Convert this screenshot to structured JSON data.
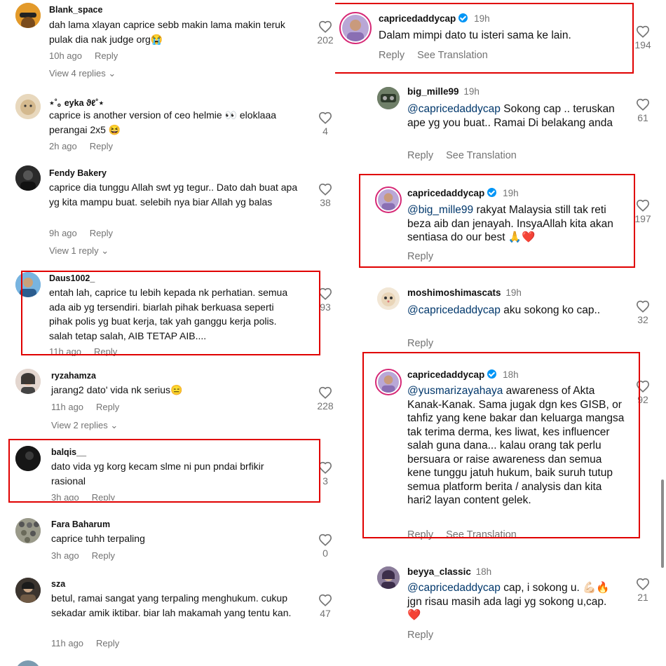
{
  "left_comments": [
    {
      "user": "Blank_space",
      "text": "dah lama xlayan caprice sebb makin lama makin teruk pulak dia nak judge org😭",
      "time": "10h ago",
      "reply": "Reply",
      "likes": "202",
      "view_replies": "View 4 replies"
    },
    {
      "user": "⋆˚｡ eyka ϑℓ˚⋆",
      "text": "caprice is another version of ceo helmie 👀 eloklaaa perangai 2x5 😆",
      "time": "2h ago",
      "reply": "Reply",
      "likes": "4"
    },
    {
      "user": "Fendy Bakery",
      "text": "caprice dia tunggu Allah swt yg tegur.. Dato dah buat apa yg kita mampu buat. selebih nya biar Allah yg balas",
      "time": "9h ago",
      "reply": "Reply",
      "likes": "38",
      "view_replies": "View 1 reply"
    },
    {
      "user": "Daus1002_",
      "text": "entah lah, caprice tu lebih kepada nk perhatian. semua ada aib yg tersendiri. biarlah pihak berkuasa seperti pihak polis yg buat kerja, tak yah ganggu kerja polis. salah tetap salah, AIB TETAP AIB....",
      "time": "11h ago",
      "reply": "Reply",
      "likes": "93"
    },
    {
      "user": "ryzahamza",
      "text": "jarang2 dato' vida nk serius😑",
      "time": "11h ago",
      "reply": "Reply",
      "likes": "228",
      "view_replies": "View 2 replies"
    },
    {
      "user": "balqis__",
      "text": "dato vida yg korg kecam slme ni pun pndai brfikir rasional",
      "time": "3h ago",
      "reply": "Reply",
      "likes": "3"
    },
    {
      "user": "Fara Baharum",
      "text": "caprice tuhh terpaling",
      "time": "3h ago",
      "reply": "Reply",
      "likes": "0"
    },
    {
      "user": "sza",
      "text": "betul, ramai sangat yang terpaling menghukum. cukup sekadar amik iktibar. biar lah makamah yang tentu kan.",
      "time": "11h ago",
      "reply": "Reply",
      "likes": "47"
    }
  ],
  "right_comments": [
    {
      "user": "capricedaddycap",
      "verified": true,
      "age": "19h",
      "mention": "",
      "text": "Dalam mimpi dato tu isteri sama ke lain.",
      "reply": "Reply",
      "translate": "See Translation",
      "likes": "194"
    },
    {
      "user": "big_mille99",
      "age": "19h",
      "mention": "@capricedaddycap",
      "text": " Sokong cap .. teruskan ape yg you buat.. Ramai Di belakang anda",
      "reply": "Reply",
      "translate": "See Translation",
      "likes": "61"
    },
    {
      "user": "capricedaddycap",
      "verified": true,
      "age": "19h",
      "mention": "@big_mille99",
      "text": " rakyat Malaysia still tak reti beza aib dan jenayah. InsyaAllah kita akan sentiasa do our best 🙏❤️",
      "reply": "Reply",
      "likes": "197"
    },
    {
      "user": "moshimoshimascats",
      "age": "19h",
      "mention": "@capricedaddycap",
      "text": " aku sokong ko cap..",
      "reply": "Reply",
      "likes": "32"
    },
    {
      "user": "capricedaddycap",
      "verified": true,
      "age": "18h",
      "mention": "@yusmarizayahaya",
      "text": " awareness of Akta Kanak-Kanak. Sama jugak dgn kes GISB, or tahfiz yang kene bakar dan keluarga mangsa tak terima derma, kes liwat, kes influencer salah guna dana... kalau orang tak perlu bersuara or raise awareness dan semua kene tunggu jatuh hukum, baik suruh tutup semua platform berita / analysis dan kita hari2 layan content gelek.",
      "reply": "Reply",
      "translate": "See Translation",
      "likes": "92"
    },
    {
      "user": "beyya_classic",
      "age": "18h",
      "mention": "@capricedaddycap",
      "text": " cap, i sokong u. 💪🏻🔥 jgn risau masih ada lagi yg sokong u,cap. ❤️",
      "reply": "Reply",
      "likes": "21"
    }
  ],
  "colors": {
    "highlight": "#e00000",
    "mention": "#00376b",
    "secondary": "#737373",
    "verified": "#0095f6"
  }
}
